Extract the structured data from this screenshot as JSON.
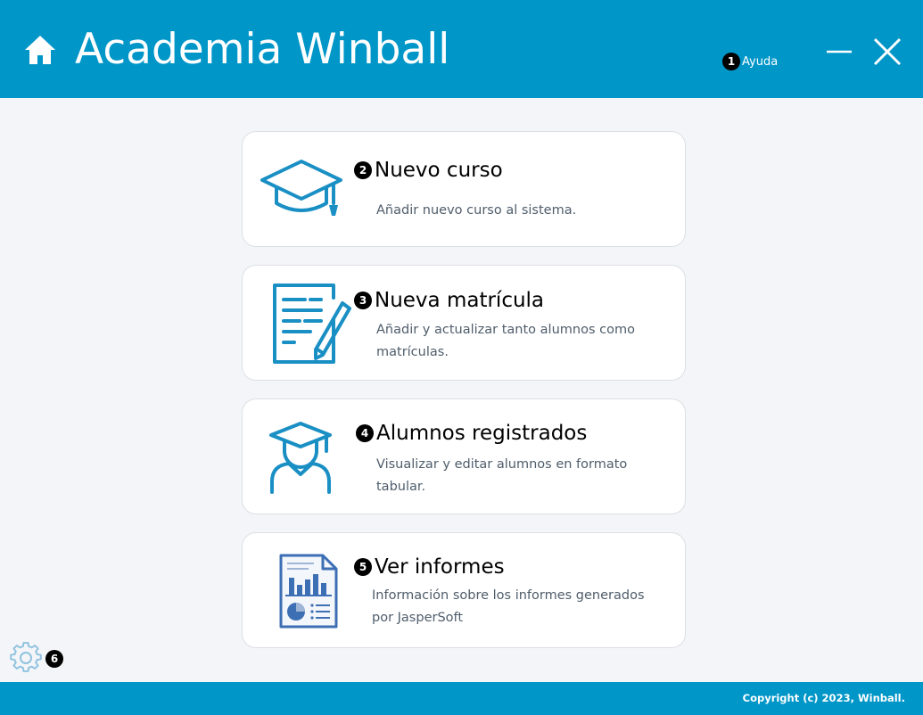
{
  "header": {
    "title": "Academia Winball",
    "help_badge": "1",
    "help_label": "Ayuda"
  },
  "cards": [
    {
      "badge": "2",
      "title": "Nuevo curso",
      "description": "Añadir nuevo curso al sistema."
    },
    {
      "badge": "3",
      "title": "Nueva matrícula",
      "description": "Añadir y actualizar tanto alumnos como matrículas."
    },
    {
      "badge": "4",
      "title": "Alumnos registrados",
      "description": "Visualizar y editar alumnos en formato tabular."
    },
    {
      "badge": "5",
      "title": "Ver informes",
      "description": "Información sobre los informes generados por JasperSoft"
    }
  ],
  "settings": {
    "badge": "6",
    "icon": "gear-icon"
  },
  "footer": {
    "copyright": "Copyright (c) 2023, Winball."
  },
  "colors": {
    "primary": "#0096c8",
    "background": "#f4f5f8",
    "card_border": "#dcdfe4",
    "icon_blue": "#1a8fc4",
    "report_blue": "#3d6fb4"
  }
}
